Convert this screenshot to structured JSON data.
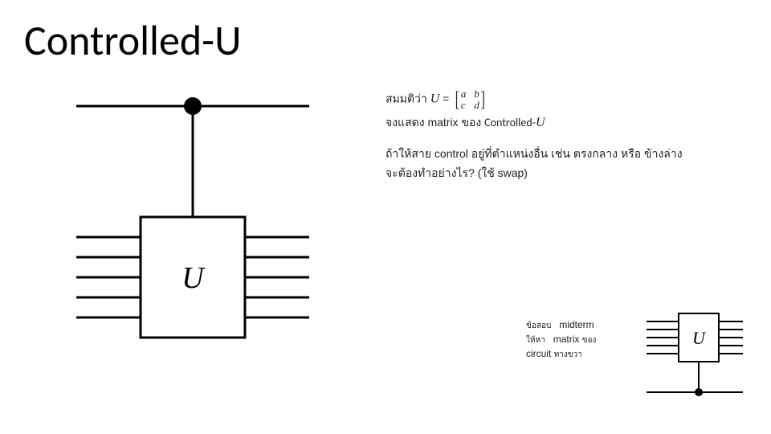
{
  "title": "Controlled-U",
  "problem": {
    "line1_prefix": "สมมติว่า ",
    "u_symbol": "U",
    "equals": " = ",
    "matrix": {
      "a": "a",
      "b": "b",
      "c": "c",
      "d": "d"
    },
    "line2_prefix": "จงแสดง ",
    "line2_matrix_word": "matrix",
    "line2_mid": " ของ ",
    "line2_ctrlU": "Controlled-",
    "line2_U": "U",
    "line3": "ถ้าให้สาย control อยู่ที่ตำแหน่งอื่น เช่น ตรงกลาง หรือ ข้างล่าง",
    "line4": "จะต้องทำอย่างไร? (ใช้ swap)"
  },
  "midterm": {
    "l1a": "ข้อสอบ",
    "l1b": "midterm",
    "l2a": "ให้หา",
    "l2b": "matrix",
    "l2c": "ของ",
    "l3a": "circuit",
    "l3b": "ทางขวา"
  },
  "diagram": {
    "main_label": "U",
    "small_label": "U"
  }
}
